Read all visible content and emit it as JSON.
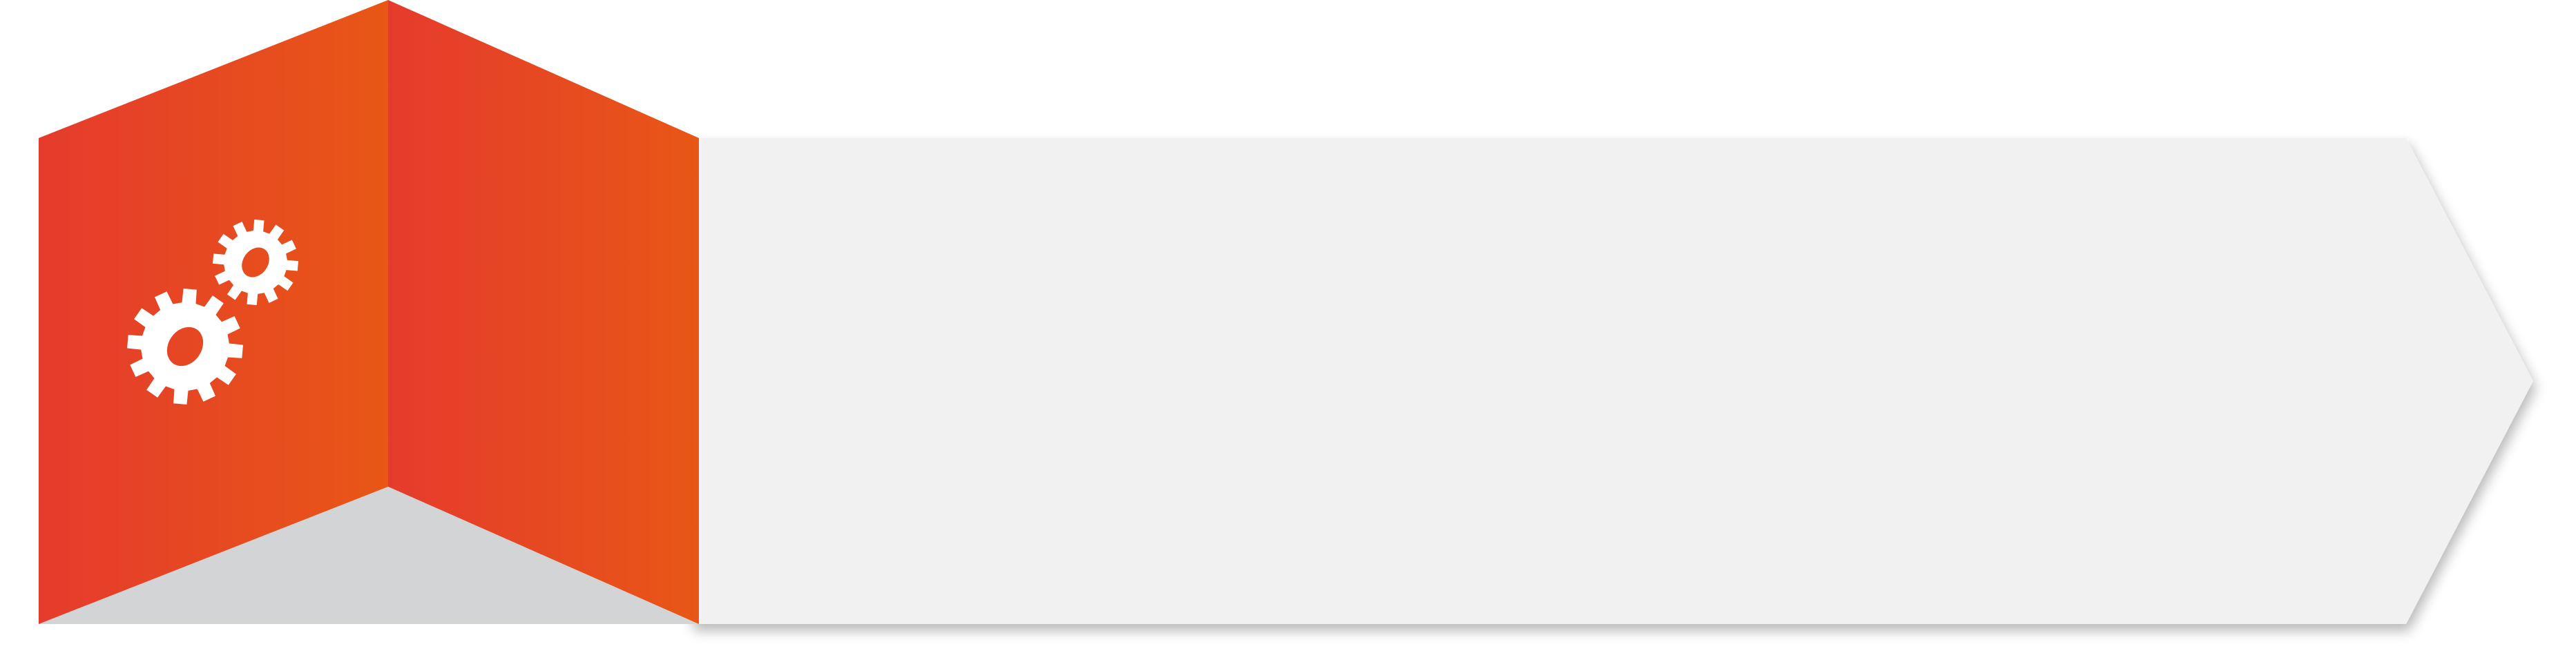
{
  "infographic": {
    "arrow_banner": {
      "fill_color": "#f0f1f0",
      "shadow_color": "#c8c9c8"
    },
    "folded_panel": {
      "gradient_start": "#e53b2d",
      "gradient_end": "#e85716",
      "fold_shadow_color": "#d3d4d6"
    },
    "icon": {
      "name": "gears-icon",
      "color": "#ffffff"
    }
  }
}
